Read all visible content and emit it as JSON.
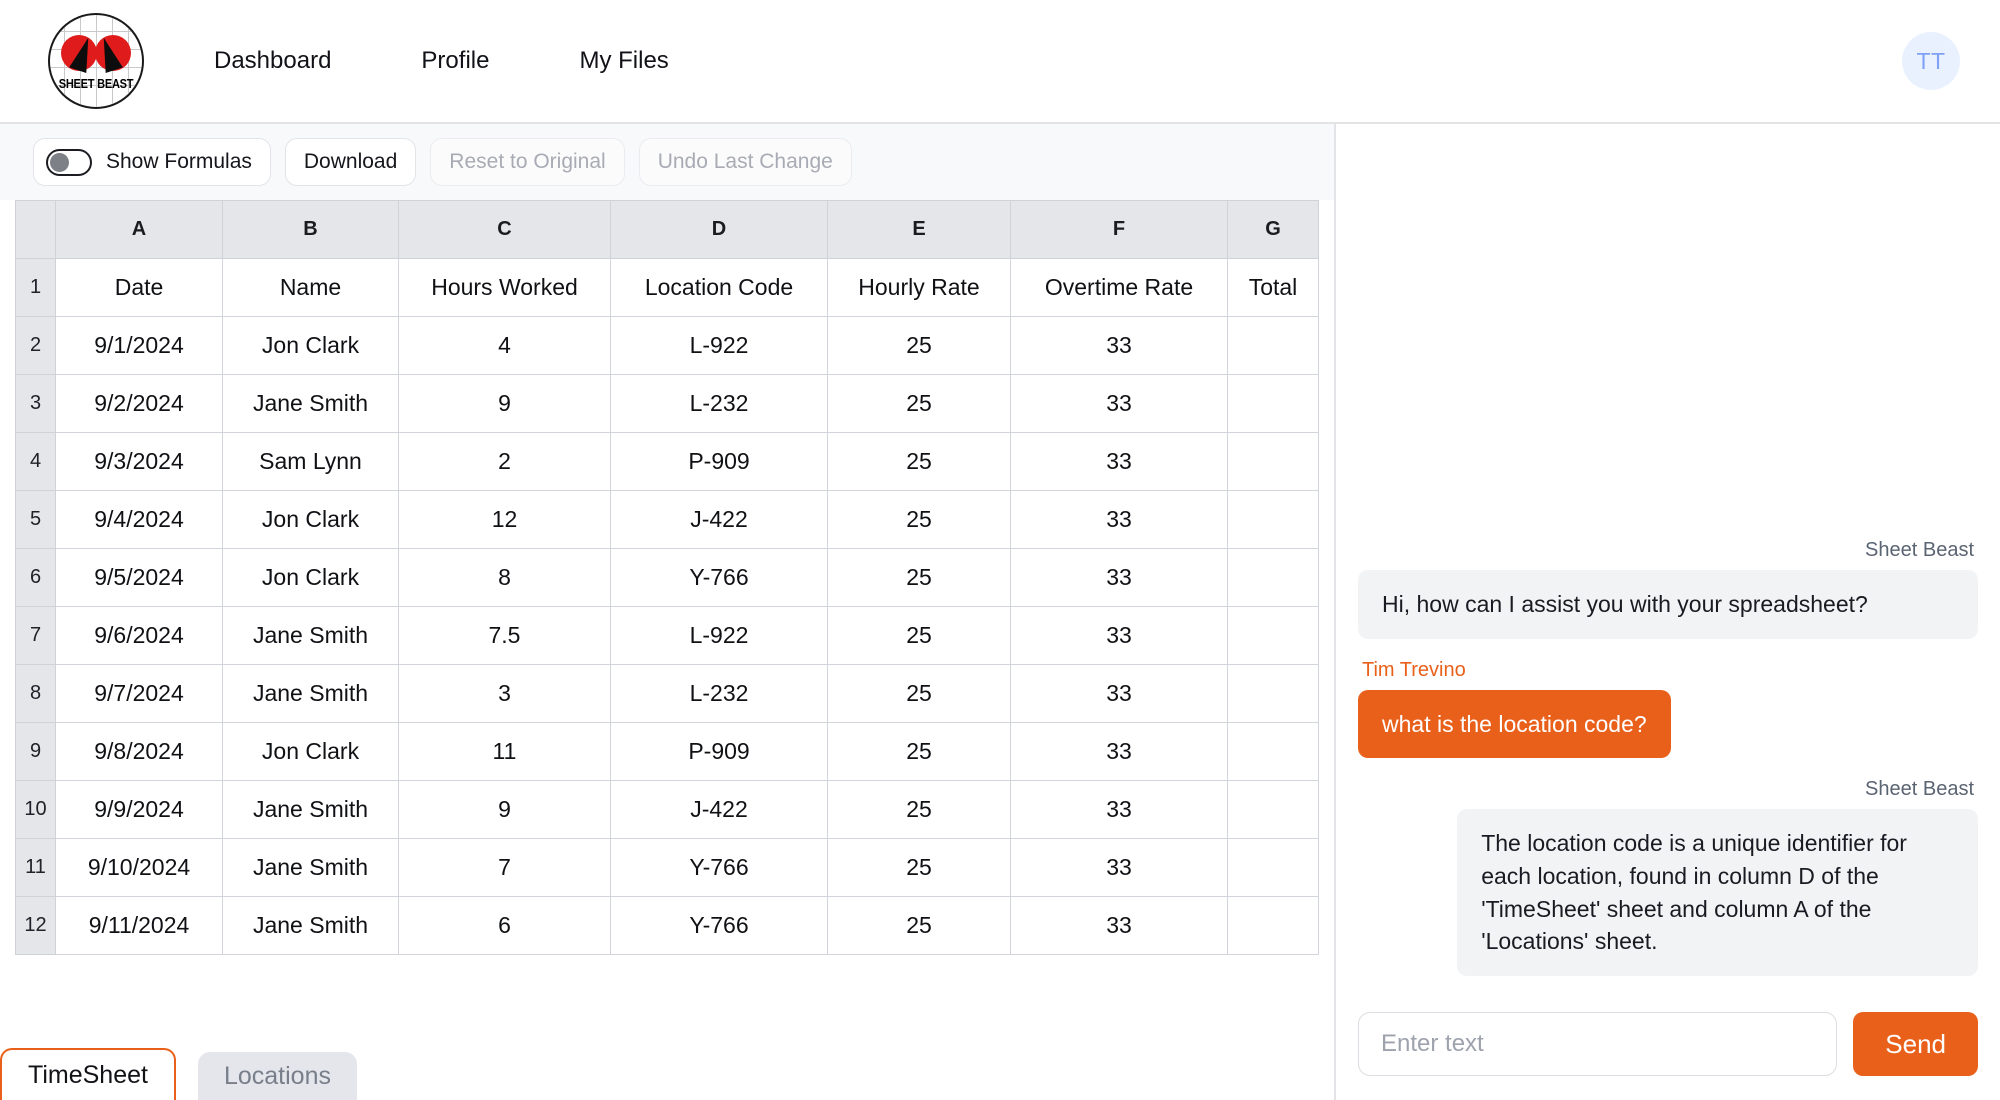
{
  "app": {
    "logo_text": "SHEET BEAST",
    "brand_color": "#e9601a"
  },
  "navbar": {
    "links": [
      {
        "label": "Dashboard"
      },
      {
        "label": "Profile"
      },
      {
        "label": "My Files"
      }
    ],
    "avatar_initials": "TT"
  },
  "toolbar": {
    "show_formulas_label": "Show Formulas",
    "show_formulas_on": false,
    "download_label": "Download",
    "reset_label": "Reset to Original",
    "undo_label": "Undo Last Change"
  },
  "spreadsheet": {
    "column_letters": [
      "A",
      "B",
      "C",
      "D",
      "E",
      "F",
      "G"
    ],
    "rows": [
      {
        "n": "1",
        "cells": [
          "Date",
          "Name",
          "Hours Worked",
          "Location Code",
          "Hourly Rate",
          "Overtime Rate",
          "Total"
        ]
      },
      {
        "n": "2",
        "cells": [
          "9/1/2024",
          "Jon Clark",
          "4",
          "L-922",
          "25",
          "33",
          ""
        ]
      },
      {
        "n": "3",
        "cells": [
          "9/2/2024",
          "Jane Smith",
          "9",
          "L-232",
          "25",
          "33",
          ""
        ]
      },
      {
        "n": "4",
        "cells": [
          "9/3/2024",
          "Sam Lynn",
          "2",
          "P-909",
          "25",
          "33",
          ""
        ]
      },
      {
        "n": "5",
        "cells": [
          "9/4/2024",
          "Jon Clark",
          "12",
          "J-422",
          "25",
          "33",
          ""
        ]
      },
      {
        "n": "6",
        "cells": [
          "9/5/2024",
          "Jon Clark",
          "8",
          "Y-766",
          "25",
          "33",
          ""
        ]
      },
      {
        "n": "7",
        "cells": [
          "9/6/2024",
          "Jane Smith",
          "7.5",
          "L-922",
          "25",
          "33",
          ""
        ]
      },
      {
        "n": "8",
        "cells": [
          "9/7/2024",
          "Jane Smith",
          "3",
          "L-232",
          "25",
          "33",
          ""
        ]
      },
      {
        "n": "9",
        "cells": [
          "9/8/2024",
          "Jon Clark",
          "11",
          "P-909",
          "25",
          "33",
          ""
        ]
      },
      {
        "n": "10",
        "cells": [
          "9/9/2024",
          "Jane Smith",
          "9",
          "J-422",
          "25",
          "33",
          ""
        ]
      },
      {
        "n": "11",
        "cells": [
          "9/10/2024",
          "Jane Smith",
          "7",
          "Y-766",
          "25",
          "33",
          ""
        ]
      },
      {
        "n": "12",
        "cells": [
          "9/11/2024",
          "Jane Smith",
          "6",
          "Y-766",
          "25",
          "33",
          ""
        ]
      }
    ]
  },
  "sheet_tabs": [
    {
      "label": "TimeSheet",
      "active": true
    },
    {
      "label": "Locations",
      "active": false
    }
  ],
  "chat": {
    "messages": [
      {
        "author": "Sheet Beast",
        "role": "bot",
        "text": "Hi, how can I assist you with your spreadsheet?"
      },
      {
        "author": "Tim Trevino",
        "role": "user",
        "text": "what is the location code?"
      },
      {
        "author": "Sheet Beast",
        "role": "bot",
        "text": "The location code is a unique identifier for each location, found in column D of the 'TimeSheet' sheet and column A of the 'Locations' sheet."
      }
    ],
    "input_placeholder": "Enter text",
    "input_value": "",
    "send_label": "Send"
  }
}
